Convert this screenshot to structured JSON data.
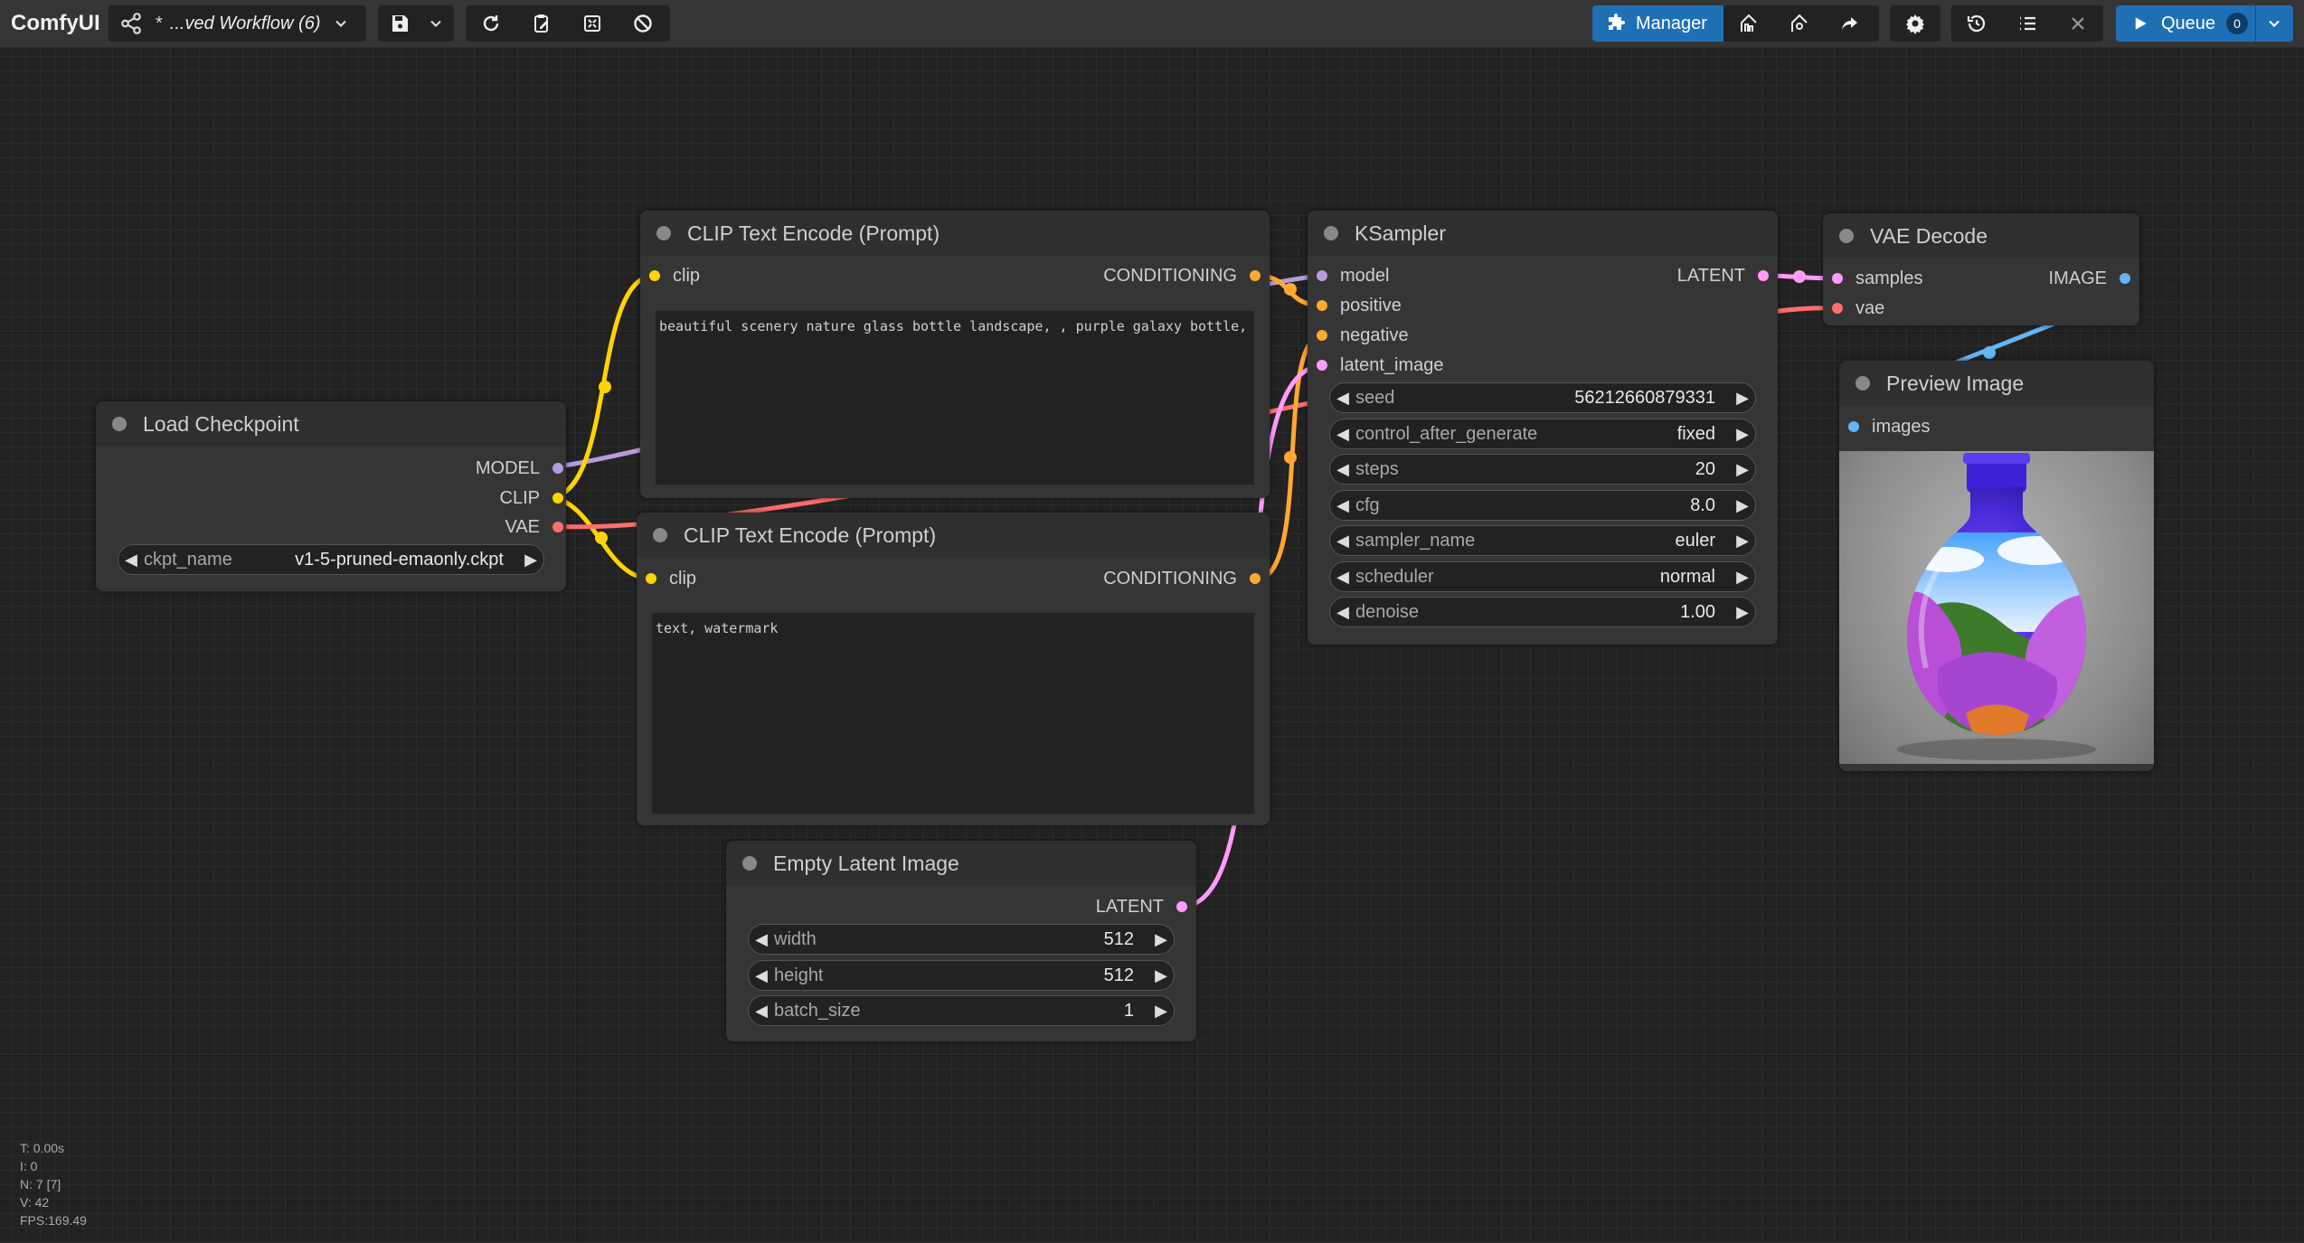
{
  "app": {
    "name": "ComfyUI"
  },
  "workflow": {
    "name": "...ved Workflow (6)",
    "modified_marker": "*"
  },
  "toolbar": {
    "manager_label": "Manager",
    "queue_label": "Queue",
    "queue_count": "0"
  },
  "colors": {
    "accent": "#1f6fb5",
    "model": "#b39ddb",
    "clip": "#ffd500",
    "vae": "#ff6e6e",
    "conditioning": "#ffa931",
    "latent": "#ff9cf9",
    "image": "#64b5f6"
  },
  "nodes": {
    "load_checkpoint": {
      "title": "Load Checkpoint",
      "outputs": [
        "MODEL",
        "CLIP",
        "VAE"
      ],
      "ckpt_name_label": "ckpt_name",
      "ckpt_name_value": "v1-5-pruned-emaonly.ckpt"
    },
    "clip_pos": {
      "title": "CLIP Text Encode (Prompt)",
      "input": "clip",
      "output": "CONDITIONING",
      "text": "beautiful scenery nature glass bottle landscape, , purple galaxy bottle,"
    },
    "clip_neg": {
      "title": "CLIP Text Encode (Prompt)",
      "input": "clip",
      "output": "CONDITIONING",
      "text": "text, watermark"
    },
    "ksampler": {
      "title": "KSampler",
      "inputs": [
        "model",
        "positive",
        "negative",
        "latent_image"
      ],
      "output": "LATENT",
      "widgets": [
        {
          "name": "seed",
          "value": "56212660879331"
        },
        {
          "name": "control_after_generate",
          "value": "fixed"
        },
        {
          "name": "steps",
          "value": "20"
        },
        {
          "name": "cfg",
          "value": "8.0"
        },
        {
          "name": "sampler_name",
          "value": "euler"
        },
        {
          "name": "scheduler",
          "value": "normal"
        },
        {
          "name": "denoise",
          "value": "1.00"
        }
      ]
    },
    "vae_decode": {
      "title": "VAE Decode",
      "inputs": [
        "samples",
        "vae"
      ],
      "output": "IMAGE"
    },
    "preview": {
      "title": "Preview Image",
      "input": "images"
    },
    "empty_latent": {
      "title": "Empty Latent Image",
      "output": "LATENT",
      "widgets": [
        {
          "name": "width",
          "value": "512"
        },
        {
          "name": "height",
          "value": "512"
        },
        {
          "name": "batch_size",
          "value": "1"
        }
      ]
    }
  },
  "stats": {
    "t": "T: 0.00s",
    "i": "I: 0",
    "n": "N: 7 [7]",
    "v": "V: 42",
    "fps": "FPS:169.49"
  }
}
